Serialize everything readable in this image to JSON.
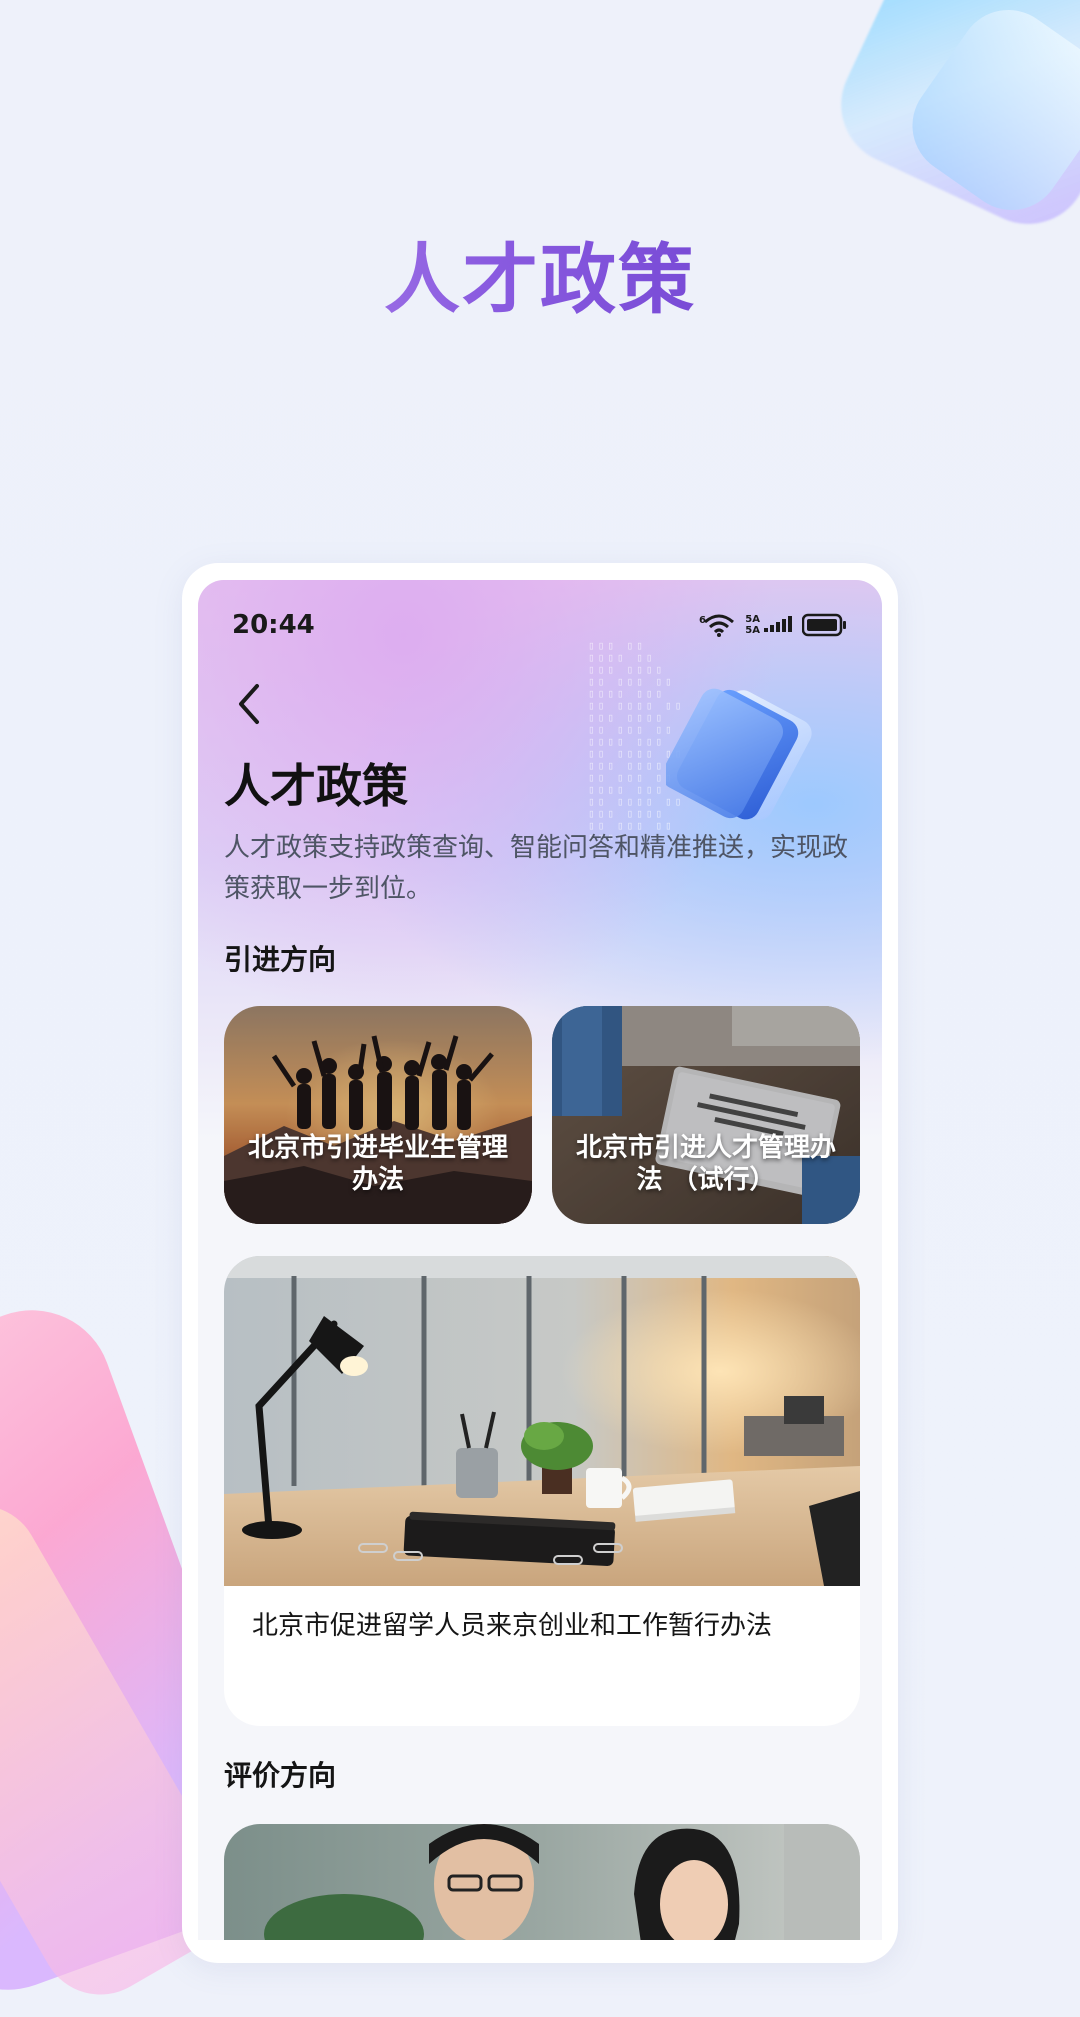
{
  "hero": {
    "title": "人才政策"
  },
  "status_bar": {
    "time": "20:44",
    "network_top": "5A",
    "network_bottom": "5A",
    "wifi_badge": "6"
  },
  "header": {
    "title": "人才政策",
    "description": "人才政策支持政策查询、智能问答和精准推送，实现政策获取一步到位。"
  },
  "sections": {
    "introduction": {
      "title": "引进方向",
      "cards": [
        {
          "label": "北京市引进毕业生管理办法"
        },
        {
          "label": "北京市引进人才管理办法 （试行）"
        }
      ],
      "feature": {
        "caption": "北京市促进留学人员来京创业和工作暂行办法"
      }
    },
    "evaluation": {
      "title": "评价方向"
    }
  },
  "icons": [
    "back-arrow-icon",
    "wifi-icon",
    "signal-icon",
    "battery-icon",
    "folder-icon"
  ]
}
